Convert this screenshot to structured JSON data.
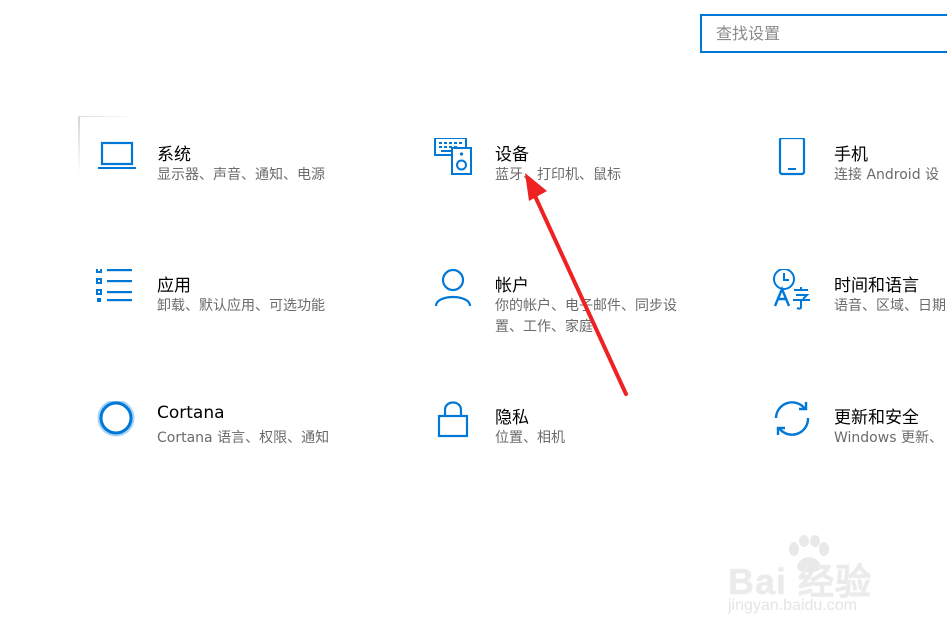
{
  "search": {
    "placeholder": "查找设置"
  },
  "tiles": [
    {
      "title": "系统",
      "desc": "显示器、声音、通知、电源",
      "icon": "laptop-icon"
    },
    {
      "title": "设备",
      "desc": "蓝牙、打印机、鼠标",
      "icon": "devices-icon"
    },
    {
      "title": "手机",
      "desc": "连接 Android 设",
      "icon": "phone-icon"
    },
    {
      "title": "应用",
      "desc": "卸载、默认应用、可选功能",
      "icon": "apps-list-icon"
    },
    {
      "title": "帐户",
      "desc": "你的帐户、电子邮件、同步设置、工作、家庭",
      "icon": "person-icon"
    },
    {
      "title": "时间和语言",
      "desc": "语音、区域、日期",
      "icon": "time-language-icon"
    },
    {
      "title": "Cortana",
      "desc": "Cortana 语言、权限、通知",
      "icon": "cortana-icon"
    },
    {
      "title": "隐私",
      "desc": "位置、相机",
      "icon": "lock-icon"
    },
    {
      "title": "更新和安全",
      "desc": "Windows 更新、",
      "icon": "sync-icon"
    }
  ],
  "watermark": {
    "main": "Bai 经验",
    "sub": "jingyan.baidu.com"
  },
  "colors": {
    "accent": "#0078d7",
    "arrow": "#ee2222",
    "text": "#000000",
    "subtext": "#6b6b6b"
  }
}
